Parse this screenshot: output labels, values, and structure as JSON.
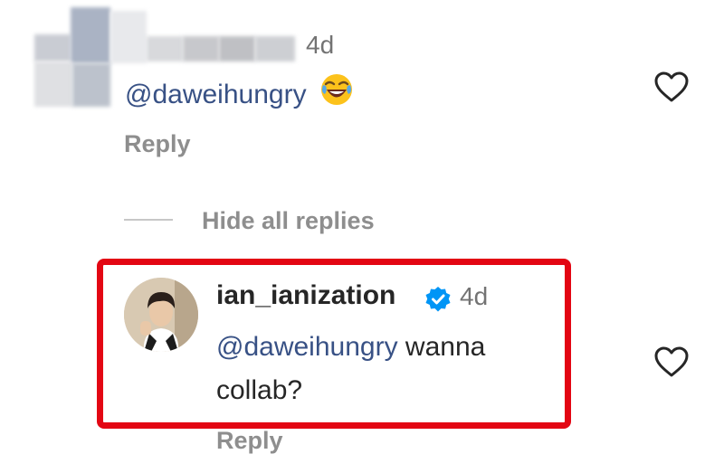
{
  "comment_1": {
    "time": "4d",
    "mention": "@daweihungry",
    "emoji": "face-with-tears-of-joy-emoji",
    "reply_label": "Reply"
  },
  "replies_toggle": {
    "label": "Hide all replies"
  },
  "comment_2": {
    "username": "ian_ianization",
    "verified": true,
    "time": "4d",
    "mention": "@daweihungry",
    "text_after_mention": " wanna collab?",
    "reply_label": "Reply",
    "highlight_color": "#e30613"
  },
  "colors": {
    "mention": "#385185",
    "meta_gray": "#8e8e8e",
    "verified_blue": "#0095f6"
  },
  "icons": {
    "like": "heart-outline-icon",
    "verified": "verified-badge-icon"
  }
}
